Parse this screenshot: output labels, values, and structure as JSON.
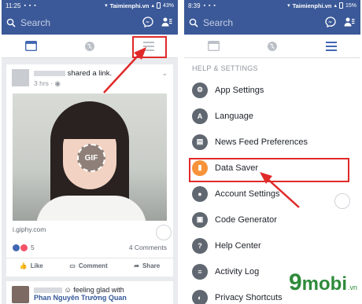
{
  "left": {
    "status": {
      "time": "11:25",
      "site": "Taimienphi.vn",
      "battery": "43%"
    },
    "search": {
      "placeholder": "Search",
      "search_icon": "search-icon",
      "messenger_icon": "messenger-icon",
      "friends_icon": "friend-requests-icon"
    },
    "tabs": [
      {
        "name": "news-feed",
        "icon": "news-feed-icon",
        "active": true
      },
      {
        "name": "globe",
        "icon": "globe-icon",
        "active": false
      },
      {
        "name": "menu",
        "icon": "hamburger-menu-icon",
        "active": false
      }
    ],
    "post": {
      "author_suffix": "shared a link.",
      "time": "3 hrs · ",
      "gif_label": "GIF",
      "link_domain": "i.giphy.com",
      "reaction_count": "5",
      "comments": "4 Comments",
      "actions": {
        "like": "Like",
        "comment": "Comment",
        "share": "Share"
      }
    },
    "post2": {
      "text": "feeling glad",
      "bold_name": "Phan Nguyên Trường Quan"
    }
  },
  "right": {
    "status": {
      "time": "8:39",
      "site": "Taimienphi.vn",
      "battery": "15%"
    },
    "search": {
      "placeholder": "Search"
    },
    "menu_header": "HELP & SETTINGS",
    "menu_items": [
      {
        "label": "App Settings",
        "icon": "gear-icon",
        "glyph": "⚙"
      },
      {
        "label": "Language",
        "icon": "language-icon",
        "glyph": "A"
      },
      {
        "label": "News Feed Preferences",
        "icon": "news-feed-preferences-icon",
        "glyph": "▤"
      },
      {
        "label": "Data Saver",
        "icon": "data-saver-icon",
        "glyph": "▮"
      },
      {
        "label": "Account Settings",
        "icon": "account-icon",
        "glyph": "●"
      },
      {
        "label": "Code Generator",
        "icon": "lock-icon",
        "glyph": "▣"
      },
      {
        "label": "Help Center",
        "icon": "help-icon",
        "glyph": "?"
      },
      {
        "label": "Activity Log",
        "icon": "activity-log-icon",
        "glyph": "≡"
      },
      {
        "label": "Privacy Shortcuts",
        "icon": "privacy-icon",
        "glyph": "◐"
      }
    ]
  },
  "watermark": {
    "nine": "9",
    "mobi": "mobi",
    "tld": ".vn"
  },
  "colors": {
    "brand": "#3b5998",
    "highlight": "#e02a2a",
    "data_saver": "#f7923a",
    "watermark": "#2e8b3a"
  }
}
